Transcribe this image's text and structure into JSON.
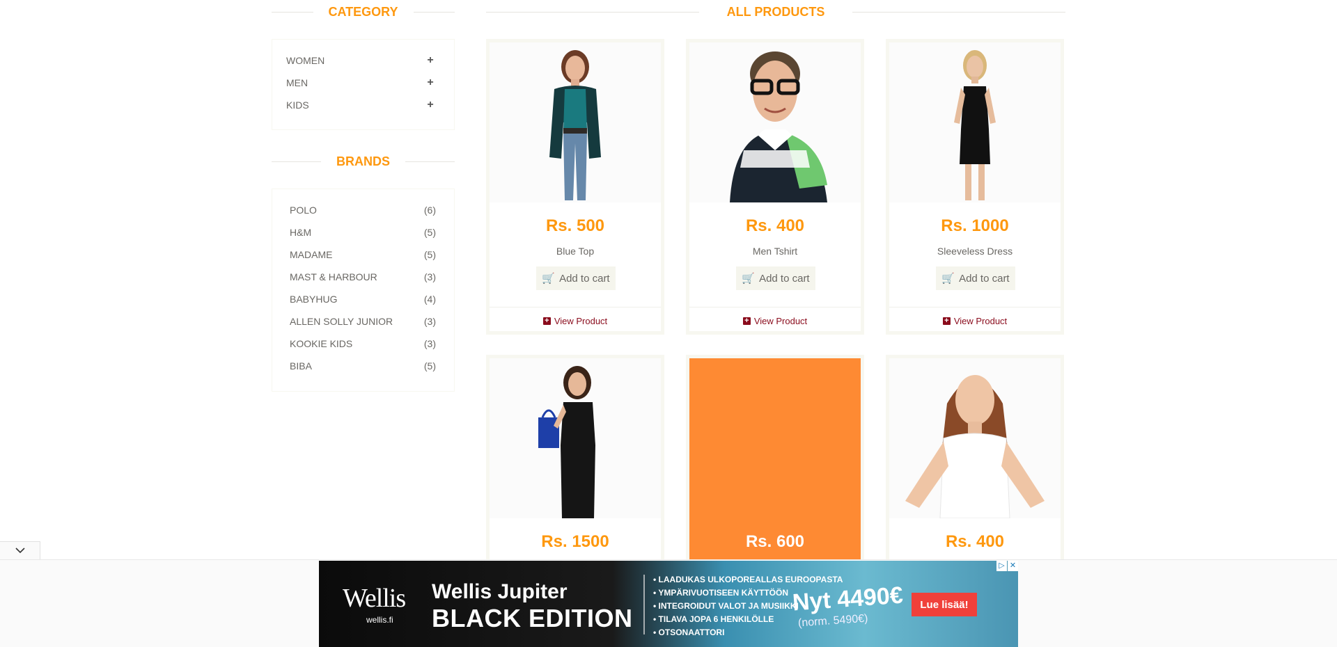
{
  "sidebar": {
    "category_title": "CATEGORY",
    "categories": [
      {
        "label": "WOMEN",
        "icon": "plus"
      },
      {
        "label": "MEN",
        "icon": "plus"
      },
      {
        "label": "KIDS",
        "icon": "plus"
      }
    ],
    "brands_title": "BRANDS",
    "brands": [
      {
        "label": "POLO",
        "count": "(6)"
      },
      {
        "label": "H&M",
        "count": "(5)"
      },
      {
        "label": "MADAME",
        "count": "(5)"
      },
      {
        "label": "MAST & HARBOUR",
        "count": "(3)"
      },
      {
        "label": "BABYHUG",
        "count": "(4)"
      },
      {
        "label": "ALLEN SOLLY JUNIOR",
        "count": "(3)"
      },
      {
        "label": "KOOKIE KIDS",
        "count": "(3)"
      },
      {
        "label": "BIBA",
        "count": "(5)"
      }
    ]
  },
  "main": {
    "title": "ALL PRODUCTS",
    "add_to_cart_label": "Add to cart",
    "view_product_label": "View Product",
    "products": [
      {
        "price": "Rs. 500",
        "name": "Blue Top"
      },
      {
        "price": "Rs. 400",
        "name": "Men Tshirt"
      },
      {
        "price": "Rs. 1000",
        "name": "Sleeveless Dress"
      },
      {
        "price": "Rs. 1500",
        "name": ""
      },
      {
        "price": "Rs. 600",
        "name": ""
      },
      {
        "price": "Rs. 400",
        "name": ""
      }
    ]
  },
  "ad": {
    "brand": "Wellis",
    "brand_site": "wellis.fi",
    "headline1": "Wellis Jupiter",
    "headline2": "BLACK EDITION",
    "bullets": [
      "• LAADUKAS ULKOPOREALLAS EUROOPASTA",
      "• YMPÄRIVUOTISEEN KÄYTTÖÖN",
      "• INTEGROIDUT VALOT JA MUSIIKKI",
      "• TILAVA JOPA 6 HENKILÖLLE",
      "• OTSONAATTORI"
    ],
    "price": "Nyt 4490€",
    "old_price": "(norm. 5490€)",
    "cta": "Lue lisää!"
  },
  "colors": {
    "accent": "#FE980F",
    "overlay": "#FE8A33",
    "view_link": "#8a0b1c"
  }
}
